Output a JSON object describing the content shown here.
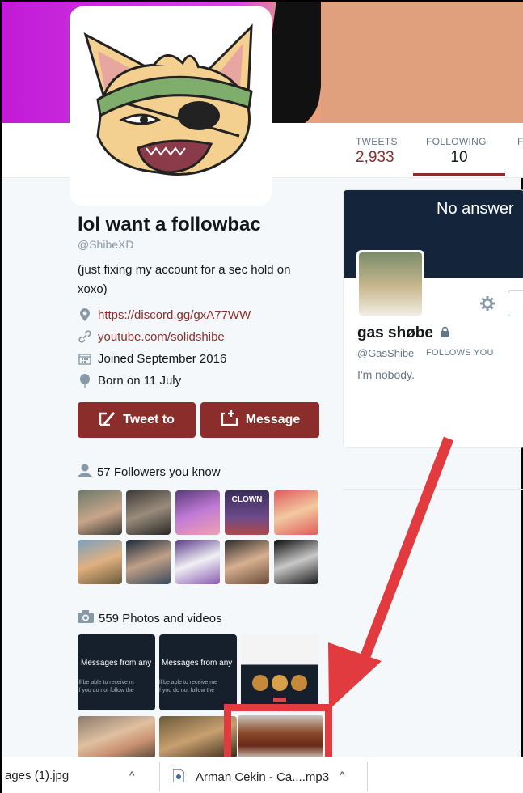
{
  "profile": {
    "name": "lol want a followbac",
    "handle": "@ShibeXD",
    "bio": "(just fixing my account for a sec hold on xoxo)",
    "website": "https://discord.gg/gxA77WW",
    "youtube": "youtube.com/solidshibe",
    "joined": "Joined September 2016",
    "born": "Born on 11 July"
  },
  "stats": [
    {
      "label": "TWEETS",
      "value": "2,933"
    },
    {
      "label": "FOLLOWING",
      "value": "10"
    },
    {
      "label": "F",
      "value": ""
    }
  ],
  "buttons": {
    "tweet_to": "Tweet to",
    "message": "Message"
  },
  "followers_you_know": "57 Followers you know",
  "photos_videos": "559 Photos and videos",
  "photo_texts": {
    "messages_from": "Messages from any",
    "small_line_1": "ill be able to receive m",
    "small_line_2": "if you do not follow the",
    "small_line_1b": "ll be able to receive me",
    "small_line_2b": "f you do not follow the"
  },
  "follower_thumb_labels": {
    "clown": "CLOWN"
  },
  "card": {
    "banner_text": "No answer",
    "name": "gas shøbe",
    "handle": "@GasShibe",
    "follows_you": "FOLLOWS YOU",
    "bio": "I'm nobody."
  },
  "downloads": [
    {
      "name": "ages (1).jpg"
    },
    {
      "name": "Arman Cekin - Ca....mp3"
    }
  ],
  "colors": {
    "accent": "#8b2d2a",
    "annotation": "#e23b3f",
    "card_banner": "#14243a"
  }
}
